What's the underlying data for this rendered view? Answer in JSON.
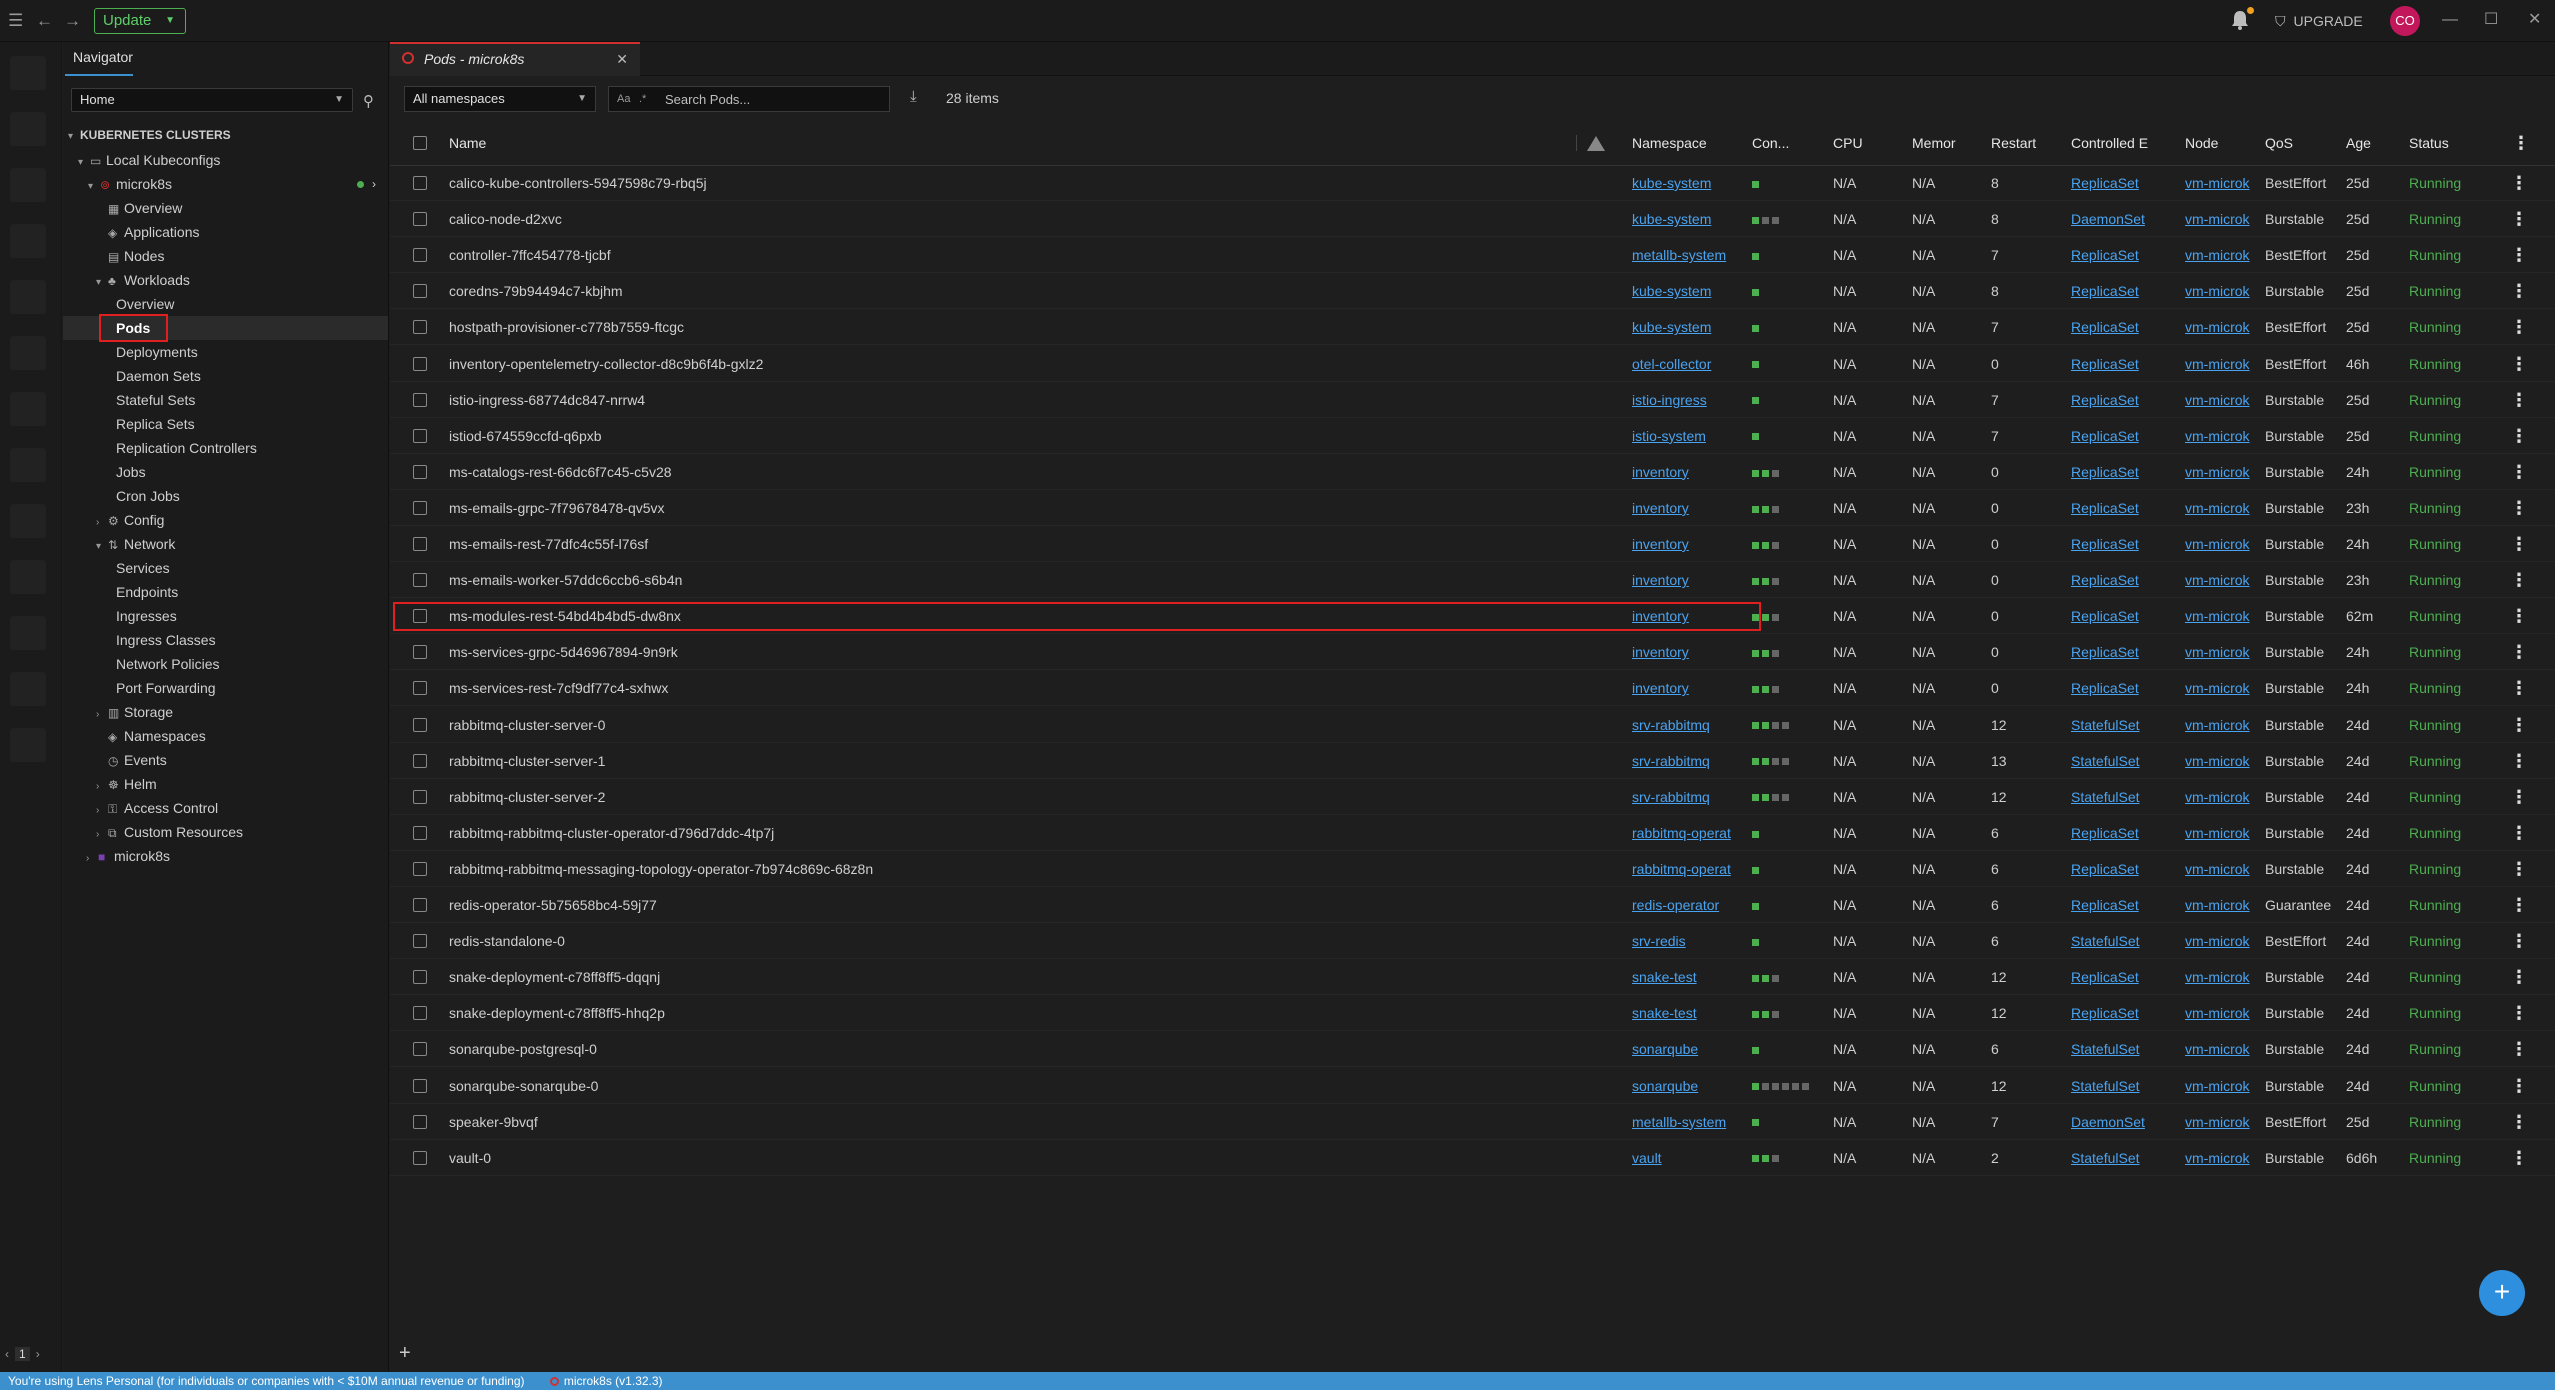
{
  "topbar": {
    "update_label": "Update",
    "upgrade_label": "UPGRADE",
    "avatar_initials": "CO"
  },
  "navigator": {
    "title": "Navigator",
    "selector_value": "Home",
    "clusters_heading": "KUBERNETES CLUSTERS",
    "local_kubeconfigs": "Local Kubeconfigs",
    "cluster_name": "microk8s",
    "items": {
      "overview": "Overview",
      "applications": "Applications",
      "nodes": "Nodes",
      "workloads": "Workloads",
      "workloads_overview": "Overview",
      "pods": "Pods",
      "deployments": "Deployments",
      "daemon_sets": "Daemon Sets",
      "stateful_sets": "Stateful Sets",
      "replica_sets": "Replica Sets",
      "replication_controllers": "Replication Controllers",
      "jobs": "Jobs",
      "cron_jobs": "Cron Jobs",
      "config": "Config",
      "network": "Network",
      "services": "Services",
      "endpoints": "Endpoints",
      "ingresses": "Ingresses",
      "ingress_classes": "Ingress Classes",
      "network_policies": "Network Policies",
      "port_forwarding": "Port Forwarding",
      "storage": "Storage",
      "namespaces": "Namespaces",
      "events": "Events",
      "helm": "Helm",
      "access_control": "Access Control",
      "custom_resources": "Custom Resources",
      "second_cluster": "microk8s"
    }
  },
  "tab": {
    "title": "Pods - microk8s"
  },
  "toolbar": {
    "namespace_filter": "All namespaces",
    "search_placeholder": "Search Pods...",
    "items_count": "28 items"
  },
  "columns": {
    "name": "Name",
    "namespace": "Namespace",
    "containers": "Con...",
    "cpu": "CPU",
    "memory": "Memor",
    "restarts": "Restart",
    "controlled_by": "Controlled E",
    "node": "Node",
    "qos": "QoS",
    "age": "Age",
    "status": "Status"
  },
  "pods": [
    {
      "name": "calico-kube-controllers-5947598c79-rbq5j",
      "namespace": "kube-system",
      "containers": "g",
      "cpu": "N/A",
      "memory": "N/A",
      "restarts": "8",
      "controlled_by": "ReplicaSet",
      "node": "vm-microk",
      "qos": "BestEffort",
      "age": "25d",
      "status": "Running"
    },
    {
      "name": "calico-node-d2xvc",
      "namespace": "kube-system",
      "containers": "gdd",
      "cpu": "N/A",
      "memory": "N/A",
      "restarts": "8",
      "controlled_by": "DaemonSet",
      "node": "vm-microk",
      "qos": "Burstable",
      "age": "25d",
      "status": "Running"
    },
    {
      "name": "controller-7ffc454778-tjcbf",
      "namespace": "metallb-system",
      "containers": "g",
      "cpu": "N/A",
      "memory": "N/A",
      "restarts": "7",
      "controlled_by": "ReplicaSet",
      "node": "vm-microk",
      "qos": "BestEffort",
      "age": "25d",
      "status": "Running"
    },
    {
      "name": "coredns-79b94494c7-kbjhm",
      "namespace": "kube-system",
      "containers": "g",
      "cpu": "N/A",
      "memory": "N/A",
      "restarts": "8",
      "controlled_by": "ReplicaSet",
      "node": "vm-microk",
      "qos": "Burstable",
      "age": "25d",
      "status": "Running"
    },
    {
      "name": "hostpath-provisioner-c778b7559-ftcgc",
      "namespace": "kube-system",
      "containers": "g",
      "cpu": "N/A",
      "memory": "N/A",
      "restarts": "7",
      "controlled_by": "ReplicaSet",
      "node": "vm-microk",
      "qos": "BestEffort",
      "age": "25d",
      "status": "Running"
    },
    {
      "name": "inventory-opentelemetry-collector-d8c9b6f4b-gxlz2",
      "namespace": "otel-collector",
      "containers": "g",
      "cpu": "N/A",
      "memory": "N/A",
      "restarts": "0",
      "controlled_by": "ReplicaSet",
      "node": "vm-microk",
      "qos": "BestEffort",
      "age": "46h",
      "status": "Running"
    },
    {
      "name": "istio-ingress-68774dc847-nrrw4",
      "namespace": "istio-ingress",
      "containers": "g",
      "cpu": "N/A",
      "memory": "N/A",
      "restarts": "7",
      "controlled_by": "ReplicaSet",
      "node": "vm-microk",
      "qos": "Burstable",
      "age": "25d",
      "status": "Running"
    },
    {
      "name": "istiod-674559ccfd-q6pxb",
      "namespace": "istio-system",
      "containers": "g",
      "cpu": "N/A",
      "memory": "N/A",
      "restarts": "7",
      "controlled_by": "ReplicaSet",
      "node": "vm-microk",
      "qos": "Burstable",
      "age": "25d",
      "status": "Running"
    },
    {
      "name": "ms-catalogs-rest-66dc6f7c45-c5v28",
      "namespace": "inventory",
      "containers": "ggd",
      "cpu": "N/A",
      "memory": "N/A",
      "restarts": "0",
      "controlled_by": "ReplicaSet",
      "node": "vm-microk",
      "qos": "Burstable",
      "age": "24h",
      "status": "Running"
    },
    {
      "name": "ms-emails-grpc-7f79678478-qv5vx",
      "namespace": "inventory",
      "containers": "ggd",
      "cpu": "N/A",
      "memory": "N/A",
      "restarts": "0",
      "controlled_by": "ReplicaSet",
      "node": "vm-microk",
      "qos": "Burstable",
      "age": "23h",
      "status": "Running"
    },
    {
      "name": "ms-emails-rest-77dfc4c55f-l76sf",
      "namespace": "inventory",
      "containers": "ggd",
      "cpu": "N/A",
      "memory": "N/A",
      "restarts": "0",
      "controlled_by": "ReplicaSet",
      "node": "vm-microk",
      "qos": "Burstable",
      "age": "24h",
      "status": "Running"
    },
    {
      "name": "ms-emails-worker-57ddc6ccb6-s6b4n",
      "namespace": "inventory",
      "containers": "ggd",
      "cpu": "N/A",
      "memory": "N/A",
      "restarts": "0",
      "controlled_by": "ReplicaSet",
      "node": "vm-microk",
      "qos": "Burstable",
      "age": "23h",
      "status": "Running"
    },
    {
      "name": "ms-modules-rest-54bd4b4bd5-dw8nx",
      "namespace": "inventory",
      "containers": "ggd",
      "cpu": "N/A",
      "memory": "N/A",
      "restarts": "0",
      "controlled_by": "ReplicaSet",
      "node": "vm-microk",
      "qos": "Burstable",
      "age": "62m",
      "status": "Running"
    },
    {
      "name": "ms-services-grpc-5d46967894-9n9rk",
      "namespace": "inventory",
      "containers": "ggd",
      "cpu": "N/A",
      "memory": "N/A",
      "restarts": "0",
      "controlled_by": "ReplicaSet",
      "node": "vm-microk",
      "qos": "Burstable",
      "age": "24h",
      "status": "Running"
    },
    {
      "name": "ms-services-rest-7cf9df77c4-sxhwx",
      "namespace": "inventory",
      "containers": "ggd",
      "cpu": "N/A",
      "memory": "N/A",
      "restarts": "0",
      "controlled_by": "ReplicaSet",
      "node": "vm-microk",
      "qos": "Burstable",
      "age": "24h",
      "status": "Running"
    },
    {
      "name": "rabbitmq-cluster-server-0",
      "namespace": "srv-rabbitmq",
      "containers": "ggdd",
      "cpu": "N/A",
      "memory": "N/A",
      "restarts": "12",
      "controlled_by": "StatefulSet",
      "node": "vm-microk",
      "qos": "Burstable",
      "age": "24d",
      "status": "Running"
    },
    {
      "name": "rabbitmq-cluster-server-1",
      "namespace": "srv-rabbitmq",
      "containers": "ggdd",
      "cpu": "N/A",
      "memory": "N/A",
      "restarts": "13",
      "controlled_by": "StatefulSet",
      "node": "vm-microk",
      "qos": "Burstable",
      "age": "24d",
      "status": "Running"
    },
    {
      "name": "rabbitmq-cluster-server-2",
      "namespace": "srv-rabbitmq",
      "containers": "ggdd",
      "cpu": "N/A",
      "memory": "N/A",
      "restarts": "12",
      "controlled_by": "StatefulSet",
      "node": "vm-microk",
      "qos": "Burstable",
      "age": "24d",
      "status": "Running"
    },
    {
      "name": "rabbitmq-rabbitmq-cluster-operator-d796d7ddc-4tp7j",
      "namespace": "rabbitmq-operat",
      "containers": "g",
      "cpu": "N/A",
      "memory": "N/A",
      "restarts": "6",
      "controlled_by": "ReplicaSet",
      "node": "vm-microk",
      "qos": "Burstable",
      "age": "24d",
      "status": "Running"
    },
    {
      "name": "rabbitmq-rabbitmq-messaging-topology-operator-7b974c869c-68z8n",
      "namespace": "rabbitmq-operat",
      "containers": "g",
      "cpu": "N/A",
      "memory": "N/A",
      "restarts": "6",
      "controlled_by": "ReplicaSet",
      "node": "vm-microk",
      "qos": "Burstable",
      "age": "24d",
      "status": "Running"
    },
    {
      "name": "redis-operator-5b75658bc4-59j77",
      "namespace": "redis-operator",
      "containers": "g",
      "cpu": "N/A",
      "memory": "N/A",
      "restarts": "6",
      "controlled_by": "ReplicaSet",
      "node": "vm-microk",
      "qos": "Guarantee",
      "age": "24d",
      "status": "Running"
    },
    {
      "name": "redis-standalone-0",
      "namespace": "srv-redis",
      "containers": "g",
      "cpu": "N/A",
      "memory": "N/A",
      "restarts": "6",
      "controlled_by": "StatefulSet",
      "node": "vm-microk",
      "qos": "BestEffort",
      "age": "24d",
      "status": "Running"
    },
    {
      "name": "snake-deployment-c78ff8ff5-dqqnj",
      "namespace": "snake-test",
      "containers": "ggd",
      "cpu": "N/A",
      "memory": "N/A",
      "restarts": "12",
      "controlled_by": "ReplicaSet",
      "node": "vm-microk",
      "qos": "Burstable",
      "age": "24d",
      "status": "Running"
    },
    {
      "name": "snake-deployment-c78ff8ff5-hhq2p",
      "namespace": "snake-test",
      "containers": "ggd",
      "cpu": "N/A",
      "memory": "N/A",
      "restarts": "12",
      "controlled_by": "ReplicaSet",
      "node": "vm-microk",
      "qos": "Burstable",
      "age": "24d",
      "status": "Running"
    },
    {
      "name": "sonarqube-postgresql-0",
      "namespace": "sonarqube",
      "containers": "g",
      "cpu": "N/A",
      "memory": "N/A",
      "restarts": "6",
      "controlled_by": "StatefulSet",
      "node": "vm-microk",
      "qos": "Burstable",
      "age": "24d",
      "status": "Running"
    },
    {
      "name": "sonarqube-sonarqube-0",
      "namespace": "sonarqube",
      "containers": "gddddd",
      "cpu": "N/A",
      "memory": "N/A",
      "restarts": "12",
      "controlled_by": "StatefulSet",
      "node": "vm-microk",
      "qos": "Burstable",
      "age": "24d",
      "status": "Running"
    },
    {
      "name": "speaker-9bvqf",
      "namespace": "metallb-system",
      "containers": "g",
      "cpu": "N/A",
      "memory": "N/A",
      "restarts": "7",
      "controlled_by": "DaemonSet",
      "node": "vm-microk",
      "qos": "BestEffort",
      "age": "25d",
      "status": "Running"
    },
    {
      "name": "vault-0",
      "namespace": "vault",
      "containers": "ggd",
      "cpu": "N/A",
      "memory": "N/A",
      "restarts": "2",
      "controlled_by": "StatefulSet",
      "node": "vm-microk",
      "qos": "Burstable",
      "age": "6d6h",
      "status": "Running"
    }
  ],
  "statusbar": {
    "license_text": "You're using Lens Personal (for individuals or companies with < $10M annual revenue or funding)",
    "cluster_label": "microk8s (v1.32.3)"
  },
  "hotbar": {
    "page_number": "1"
  },
  "colors": {
    "accent": "#3d90ce",
    "running": "#4caf50",
    "link": "#4aa3f0",
    "highlight_border": "#e02020"
  }
}
